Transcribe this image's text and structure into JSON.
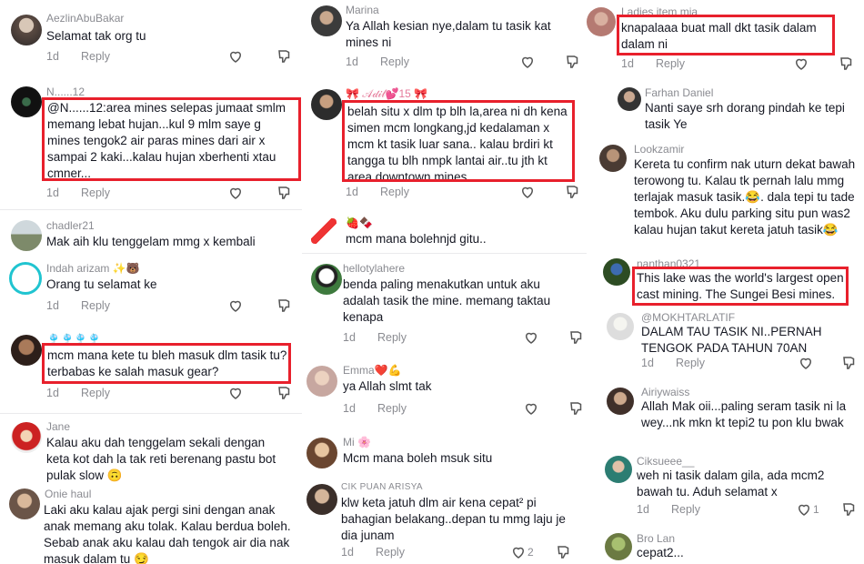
{
  "comments": [
    {
      "user": "AezlinAbuBakar",
      "text": "Selamat tak org tu",
      "date": "1d",
      "reply": "Reply"
    },
    {
      "user": "N......12",
      "text": "@N......12:area mines selepas jumaat smlm memang lebat hujan...kul 9 mlm saye g mines tengok2 air paras mines dari air x sampai 2 kaki...kalau hujan xberhenti xtau cmner...",
      "date": "1d",
      "reply": "Reply"
    },
    {
      "user": "chadler21",
      "text": "Mak aih klu tenggelam mmg x kembali"
    },
    {
      "user": "Indah arizam ✨🐻",
      "text": "Orang tu selamat ke",
      "date": "1d",
      "reply": "Reply"
    },
    {
      "user": "🎐🎐🎐🎐",
      "text": "mcm mana kete tu bleh masuk dlm tasik tu? terbabas ke salah masuk gear?",
      "date": "1d",
      "reply": "Reply"
    },
    {
      "user": "Jane",
      "text": "Kalau aku dah tenggelam sekali dengan keta kot dah la tak reti berenang pastu bot pulak slow 🙃"
    },
    {
      "user": "Onie haul",
      "text": "Laki aku kalau ajak pergi sini dengan anak anak memang aku tolak. Kalau berdua boleh. Sebab anak aku kalau dah tengok air dia nak masuk dalam tu 😏"
    },
    {
      "user": "Marina",
      "text": "Ya Allah kesian nye,dalam tu tasik kat mines ni",
      "date": "1d",
      "reply": "Reply"
    },
    {
      "user": "🎀 𝒜𝒹𝒾𝓁💕15 🎀",
      "text": "belah situ x dlm tp blh la,area ni dh kena simen mcm longkang,jd kedalaman x mcm kt tasik luar sana.. kalau brdiri kt tangga tu blh nmpk lantai air..tu jth kt area downtown mines",
      "date": "1d",
      "reply": "Reply"
    },
    {
      "user": "🍓🍫",
      "text": "mcm mana bolehnjd gitu.."
    },
    {
      "user": "hellotylahere",
      "text": "benda paling menakutkan untuk aku adalah tasik the mine. memang taktau kenapa",
      "date": "1d",
      "reply": "Reply"
    },
    {
      "user": "Emma❤️💪",
      "text": "ya Allah slmt tak",
      "date": "1d",
      "reply": "Reply"
    },
    {
      "user": "Mi 🌸",
      "text": "Mcm mana boleh msuk situ"
    },
    {
      "user": "CIK PUAN ARISYA",
      "text": "klw keta jatuh dlm air kena cepat² pi bahagian belakang..depan tu mmg laju je dia junam",
      "date": "1d",
      "reply": "Reply",
      "likes": "2"
    },
    {
      "user": "Ladies item mia",
      "text": "knapalaaa buat mall dkt tasik dalam dalam ni",
      "date": "1d",
      "reply": "Reply"
    },
    {
      "user": "Farhan Daniel",
      "text": "Nanti saye srh dorang pindah ke tepi tasik Ye"
    },
    {
      "user": "Lookzamir",
      "text": "Kereta tu confirm nak uturn dekat bawah terowong tu. Kalau tk pernah lalu mmg terlajak masuk tasik.😂. dala tepi tu tade tembok. Aku dulu parking situ pun was2 kalau hujan takut kereta jatuh tasik😂"
    },
    {
      "user": "nanthan0321",
      "text": "This lake was the world's largest open cast mining. The Sungei Besi mines."
    },
    {
      "user": "@MOKHTARLATIF",
      "text": "DALAM TAU TASIK NI..PERNAH TENGOK PADA TAHUN 70AN",
      "date": "1d",
      "reply": "Reply"
    },
    {
      "user": "Airiywaiss",
      "text": "Allah Mak oii...paling seram tasik ni la wey...nk mkn kt tepi2 tu pon klu bwak"
    },
    {
      "user": "Ciksueee__",
      "text": "weh ni tasik dalam gila, ada mcm2 bawah tu. Aduh selamat x",
      "date": "1d",
      "reply": "Reply",
      "likes": "1"
    },
    {
      "user": "Bro Lan",
      "text": "cepat2..."
    }
  ]
}
